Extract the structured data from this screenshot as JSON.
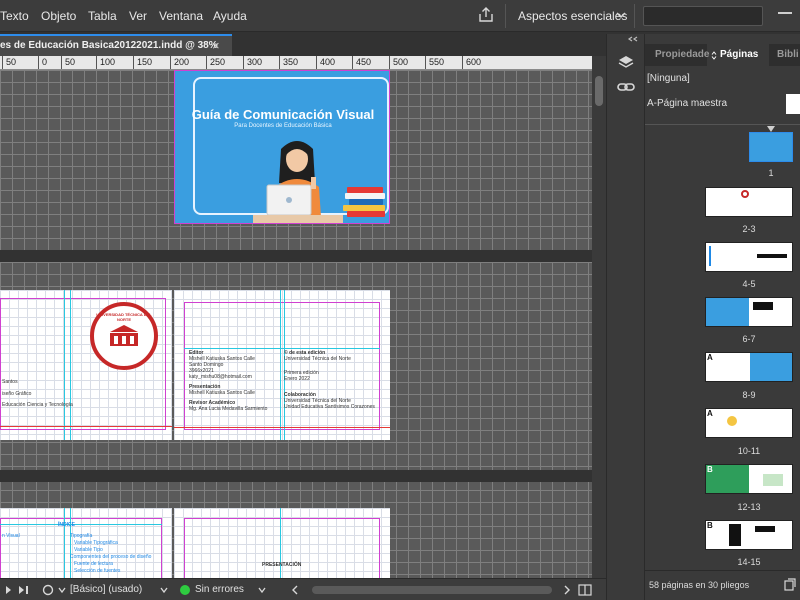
{
  "menu": {
    "items": [
      "Texto",
      "Objeto",
      "Tabla",
      "Ver",
      "Ventana",
      "Ayuda"
    ],
    "workspace_label": "Aspectos esenciales"
  },
  "document": {
    "tab_title": "es de Educación Basica20122021.indd @ 38%",
    "close_glyph": "×"
  },
  "ruler": {
    "labels": [
      "50",
      "0",
      "50",
      "100",
      "150",
      "200",
      "250",
      "300",
      "350",
      "400",
      "450",
      "500",
      "550",
      "600"
    ]
  },
  "cover": {
    "title": "Guía de Comunicación Visual",
    "subtitle": "Para Docentes de Educación Básica"
  },
  "spread2": {
    "left_lines": [
      "Santos",
      "iseño Gráfico",
      "Educación Ciencia y Tecnología"
    ],
    "seal_text": "UNIVERSIDAD TÉCNICA DEL NORTE",
    "col1": [
      {
        "text": "Editor",
        "bold": true
      },
      {
        "text": "Mishell Katiuska Santos Calle",
        "bold": false
      },
      {
        "text": "Santo Domingo",
        "bold": false
      },
      {
        "text": "3966x2021",
        "bold": false
      },
      {
        "text": "katy_mishu08@hotmail.com",
        "bold": false
      },
      {
        "text": "Presentación",
        "bold": true
      },
      {
        "text": "Mishell Katiuska Santos Calle",
        "bold": false
      },
      {
        "text": "Revisor Académico",
        "bold": true
      },
      {
        "text": "Mg. Ana Lucia Medavilla Sarmiento",
        "bold": false
      }
    ],
    "col2": [
      {
        "text": "© de esta edición",
        "bold": true
      },
      {
        "text": "Universidad Técnica del Norte",
        "bold": false
      },
      {
        "text": "Primera edición",
        "bold": false
      },
      {
        "text": "Enero 2022",
        "bold": false
      },
      {
        "text": "Colaboración",
        "bold": true
      },
      {
        "text": "Universidad Técnica del Norte",
        "bold": false
      },
      {
        "text": "Unidad Educativa Santísimos Corazones",
        "bold": false
      }
    ]
  },
  "spread3": {
    "index_title": "ÍNDICE",
    "index_lines": [
      "n Visual",
      "Tipografía",
      "Variable Tipográfica",
      "Variable Tipo",
      "Componentes del proceso de diseño",
      "Fuente de lectura",
      "Selección de fuentes"
    ],
    "presentation_title": "PRESENTACIÓN"
  },
  "status": {
    "style_label": "[Básico] (usado)",
    "errors_label": "Sin errores"
  },
  "panel": {
    "tabs": [
      "Propiedade",
      "Páginas",
      "Bibli"
    ],
    "active_tab": "Páginas",
    "none_label": "[Ninguna]",
    "master_label": "A-Página maestra",
    "pages": [
      {
        "label": "1"
      },
      {
        "label": "2-3"
      },
      {
        "label": "4-5"
      },
      {
        "label": "6-7"
      },
      {
        "label": "8-9",
        "letter": "A"
      },
      {
        "label": "10-11",
        "letter": "A"
      },
      {
        "label": "12-13",
        "letter": "B"
      },
      {
        "label": "14-15",
        "letter": "B"
      }
    ],
    "footer_text": "58 páginas en 30 pliegos"
  },
  "colors": {
    "accent": "#2d8ceb",
    "cover_blue": "#3a9ee0",
    "bleed": "#d040d0",
    "guide": "#28c8e0",
    "ok_green": "#2ecc40"
  }
}
